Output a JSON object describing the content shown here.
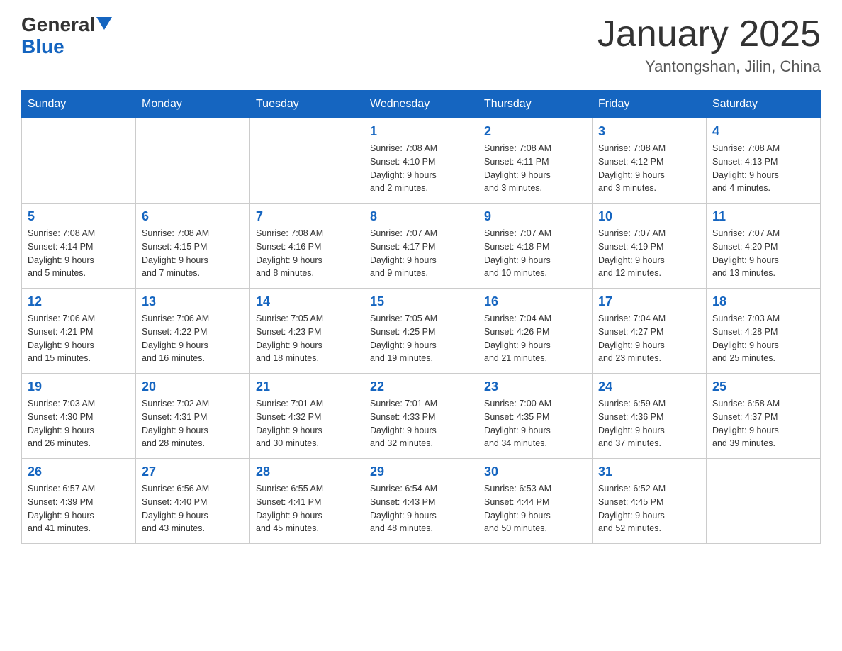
{
  "header": {
    "logo_line1": "General",
    "logo_line2": "Blue",
    "title": "January 2025",
    "subtitle": "Yantongshan, Jilin, China"
  },
  "days_of_week": [
    "Sunday",
    "Monday",
    "Tuesday",
    "Wednesday",
    "Thursday",
    "Friday",
    "Saturday"
  ],
  "weeks": [
    [
      {
        "day": "",
        "info": ""
      },
      {
        "day": "",
        "info": ""
      },
      {
        "day": "",
        "info": ""
      },
      {
        "day": "1",
        "info": "Sunrise: 7:08 AM\nSunset: 4:10 PM\nDaylight: 9 hours\nand 2 minutes."
      },
      {
        "day": "2",
        "info": "Sunrise: 7:08 AM\nSunset: 4:11 PM\nDaylight: 9 hours\nand 3 minutes."
      },
      {
        "day": "3",
        "info": "Sunrise: 7:08 AM\nSunset: 4:12 PM\nDaylight: 9 hours\nand 3 minutes."
      },
      {
        "day": "4",
        "info": "Sunrise: 7:08 AM\nSunset: 4:13 PM\nDaylight: 9 hours\nand 4 minutes."
      }
    ],
    [
      {
        "day": "5",
        "info": "Sunrise: 7:08 AM\nSunset: 4:14 PM\nDaylight: 9 hours\nand 5 minutes."
      },
      {
        "day": "6",
        "info": "Sunrise: 7:08 AM\nSunset: 4:15 PM\nDaylight: 9 hours\nand 7 minutes."
      },
      {
        "day": "7",
        "info": "Sunrise: 7:08 AM\nSunset: 4:16 PM\nDaylight: 9 hours\nand 8 minutes."
      },
      {
        "day": "8",
        "info": "Sunrise: 7:07 AM\nSunset: 4:17 PM\nDaylight: 9 hours\nand 9 minutes."
      },
      {
        "day": "9",
        "info": "Sunrise: 7:07 AM\nSunset: 4:18 PM\nDaylight: 9 hours\nand 10 minutes."
      },
      {
        "day": "10",
        "info": "Sunrise: 7:07 AM\nSunset: 4:19 PM\nDaylight: 9 hours\nand 12 minutes."
      },
      {
        "day": "11",
        "info": "Sunrise: 7:07 AM\nSunset: 4:20 PM\nDaylight: 9 hours\nand 13 minutes."
      }
    ],
    [
      {
        "day": "12",
        "info": "Sunrise: 7:06 AM\nSunset: 4:21 PM\nDaylight: 9 hours\nand 15 minutes."
      },
      {
        "day": "13",
        "info": "Sunrise: 7:06 AM\nSunset: 4:22 PM\nDaylight: 9 hours\nand 16 minutes."
      },
      {
        "day": "14",
        "info": "Sunrise: 7:05 AM\nSunset: 4:23 PM\nDaylight: 9 hours\nand 18 minutes."
      },
      {
        "day": "15",
        "info": "Sunrise: 7:05 AM\nSunset: 4:25 PM\nDaylight: 9 hours\nand 19 minutes."
      },
      {
        "day": "16",
        "info": "Sunrise: 7:04 AM\nSunset: 4:26 PM\nDaylight: 9 hours\nand 21 minutes."
      },
      {
        "day": "17",
        "info": "Sunrise: 7:04 AM\nSunset: 4:27 PM\nDaylight: 9 hours\nand 23 minutes."
      },
      {
        "day": "18",
        "info": "Sunrise: 7:03 AM\nSunset: 4:28 PM\nDaylight: 9 hours\nand 25 minutes."
      }
    ],
    [
      {
        "day": "19",
        "info": "Sunrise: 7:03 AM\nSunset: 4:30 PM\nDaylight: 9 hours\nand 26 minutes."
      },
      {
        "day": "20",
        "info": "Sunrise: 7:02 AM\nSunset: 4:31 PM\nDaylight: 9 hours\nand 28 minutes."
      },
      {
        "day": "21",
        "info": "Sunrise: 7:01 AM\nSunset: 4:32 PM\nDaylight: 9 hours\nand 30 minutes."
      },
      {
        "day": "22",
        "info": "Sunrise: 7:01 AM\nSunset: 4:33 PM\nDaylight: 9 hours\nand 32 minutes."
      },
      {
        "day": "23",
        "info": "Sunrise: 7:00 AM\nSunset: 4:35 PM\nDaylight: 9 hours\nand 34 minutes."
      },
      {
        "day": "24",
        "info": "Sunrise: 6:59 AM\nSunset: 4:36 PM\nDaylight: 9 hours\nand 37 minutes."
      },
      {
        "day": "25",
        "info": "Sunrise: 6:58 AM\nSunset: 4:37 PM\nDaylight: 9 hours\nand 39 minutes."
      }
    ],
    [
      {
        "day": "26",
        "info": "Sunrise: 6:57 AM\nSunset: 4:39 PM\nDaylight: 9 hours\nand 41 minutes."
      },
      {
        "day": "27",
        "info": "Sunrise: 6:56 AM\nSunset: 4:40 PM\nDaylight: 9 hours\nand 43 minutes."
      },
      {
        "day": "28",
        "info": "Sunrise: 6:55 AM\nSunset: 4:41 PM\nDaylight: 9 hours\nand 45 minutes."
      },
      {
        "day": "29",
        "info": "Sunrise: 6:54 AM\nSunset: 4:43 PM\nDaylight: 9 hours\nand 48 minutes."
      },
      {
        "day": "30",
        "info": "Sunrise: 6:53 AM\nSunset: 4:44 PM\nDaylight: 9 hours\nand 50 minutes."
      },
      {
        "day": "31",
        "info": "Sunrise: 6:52 AM\nSunset: 4:45 PM\nDaylight: 9 hours\nand 52 minutes."
      },
      {
        "day": "",
        "info": ""
      }
    ]
  ]
}
